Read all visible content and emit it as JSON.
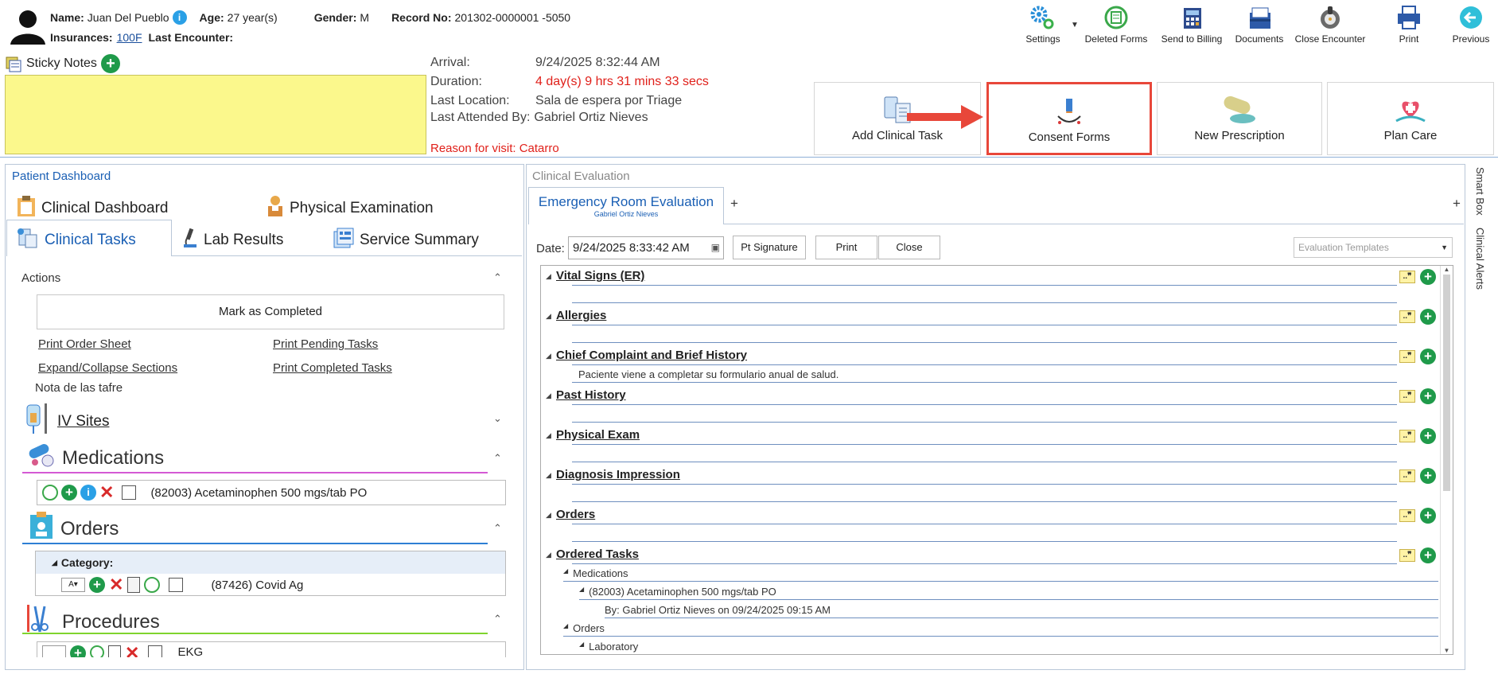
{
  "patient": {
    "name_label": "Name:",
    "name": "Juan Del Pueblo",
    "age_label": "Age:",
    "age": "27 year(s)",
    "gender_label": "Gender:",
    "gender": "M",
    "record_label": "Record No:",
    "record": "201302-0000001 -5050",
    "insurances_label": "Insurances:",
    "insurance": "100F",
    "last_encounter_label": "Last Encounter:"
  },
  "sticky": {
    "label": "Sticky Notes"
  },
  "visit": {
    "arrival_label": "Arrival:",
    "arrival": "9/24/2025 8:32:44 AM",
    "duration_label": "Duration:",
    "duration": "4 day(s) 9 hrs 31 mins 33 secs",
    "location_label": "Last Location:",
    "location": "Sala de espera por Triage",
    "attended_label": "Last Attended By:",
    "attended": "Gabriel Ortiz Nieves",
    "reason": "Reason for visit: Catarro"
  },
  "toolbar": {
    "settings": "Settings",
    "deleted_forms": "Deleted Forms",
    "send_billing": "Send to Billing",
    "documents": "Documents",
    "close_encounter": "Close Encounter",
    "print": "Print",
    "previous": "Previous"
  },
  "actions_bar": {
    "add_task": "Add Clinical Task",
    "consent": "Consent Forms",
    "prescription": "New Prescription",
    "plan_care": "Plan Care"
  },
  "dashboard": {
    "title": "Patient Dashboard",
    "tabs": [
      "Clinical Dashboard",
      "Physical Examination",
      "Clinical Tasks",
      "Lab Results",
      "Service Summary"
    ],
    "actions_label": "Actions",
    "mark_completed": "Mark as Completed",
    "print_order_sheet": "Print Order Sheet",
    "print_pending": "Print Pending Tasks",
    "expand_collapse": "Expand/Collapse Sections",
    "print_completed": "Print Completed Tasks",
    "note": "Nota de las tafre",
    "iv_sites": "IV Sites",
    "medications": "Medications",
    "medication_item": "(82003) Acetaminophen 500 mgs/tab PO",
    "orders": "Orders",
    "category_label": "Category:",
    "order_item": "(87426) Covid Ag",
    "procedures": "Procedures",
    "procedure_item": "EKG",
    "colors": {
      "medications_line": "#d45ad4",
      "orders_line": "#2e7fd4",
      "procedures_line": "#7fd42e"
    }
  },
  "evaluation": {
    "panel_title": "Clinical Evaluation",
    "tab_title": "Emergency Room Evaluation",
    "tab_sub": "Gabriel Ortiz Nieves",
    "add_tab": "+",
    "date_label": "Date:",
    "date_value": "9/24/2025 8:33:42 AM",
    "pt_signature": "Pt Signature",
    "print": "Print",
    "close": "Close",
    "templates_placeholder": "Evaluation Templates",
    "sections": [
      "Vital Signs (ER)",
      "Allergies",
      "Chief Complaint and Brief History",
      "Past History",
      "Physical Exam",
      "Diagnosis Impression",
      "Orders",
      "Ordered Tasks"
    ],
    "chief_complaint_text": "Paciente viene a completar su formulario anual de salud.",
    "tasks": {
      "medications": "Medications",
      "med_item": "(82003) Acetaminophen 500 mgs/tab PO",
      "med_by": "By: Gabriel Ortiz Nieves on 09/24/2025 09:15 AM",
      "orders": "Orders",
      "laboratory": "Laboratory"
    }
  },
  "side_tabs": {
    "smart_box": "Smart Box",
    "clinical_alerts": "Clinical Alerts"
  },
  "colors": {
    "accent": "#1a5fb4",
    "highlight": "#e8473a",
    "sticky": "#fbf88c",
    "red_text": "#e0201a"
  }
}
